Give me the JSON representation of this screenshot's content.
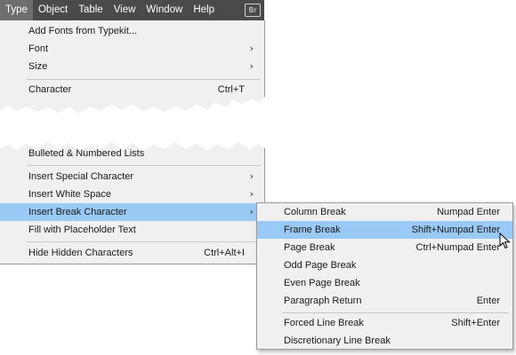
{
  "menubar": {
    "items": [
      "Type",
      "Object",
      "Table",
      "View",
      "Window",
      "Help"
    ],
    "bridge_badge": "Br"
  },
  "type_menu": {
    "items_top": [
      {
        "label": "Add Fonts from Typekit...",
        "shortcut": "",
        "submenu": false
      },
      {
        "label": "Font",
        "shortcut": "",
        "submenu": true
      },
      {
        "label": "Size",
        "shortcut": "",
        "submenu": true
      },
      {
        "label": "Character",
        "shortcut": "Ctrl+T",
        "submenu": false
      }
    ],
    "items_bottom": [
      {
        "label": "Bulleted & Numbered Lists",
        "shortcut": "",
        "submenu": false
      },
      {
        "label": "Insert Special Character",
        "shortcut": "",
        "submenu": true
      },
      {
        "label": "Insert White Space",
        "shortcut": "",
        "submenu": true
      },
      {
        "label": "Insert Break Character",
        "shortcut": "",
        "submenu": true
      },
      {
        "label": "Fill with Placeholder Text",
        "shortcut": "",
        "submenu": false
      },
      {
        "label": "Hide Hidden Characters",
        "shortcut": "Ctrl+Alt+I",
        "submenu": false
      }
    ]
  },
  "break_submenu": {
    "items": [
      {
        "label": "Column Break",
        "shortcut": "Numpad Enter"
      },
      {
        "label": "Frame Break",
        "shortcut": "Shift+Numpad Enter"
      },
      {
        "label": "Page Break",
        "shortcut": "Ctrl+Numpad Enter"
      },
      {
        "label": "Odd Page Break",
        "shortcut": ""
      },
      {
        "label": "Even Page Break",
        "shortcut": ""
      },
      {
        "label": "Paragraph Return",
        "shortcut": "Enter"
      },
      {
        "label": "Forced Line Break",
        "shortcut": "Shift+Enter"
      },
      {
        "label": "Discretionary Line Break",
        "shortcut": ""
      }
    ]
  },
  "colors": {
    "menubar_bg": "#4a4a4a",
    "menu_bg": "#f0f0f0",
    "highlight": "#99c9f5"
  },
  "icons": {
    "submenu_arrow": "chevron-right-icon",
    "cursor": "mouse-pointer-icon"
  }
}
